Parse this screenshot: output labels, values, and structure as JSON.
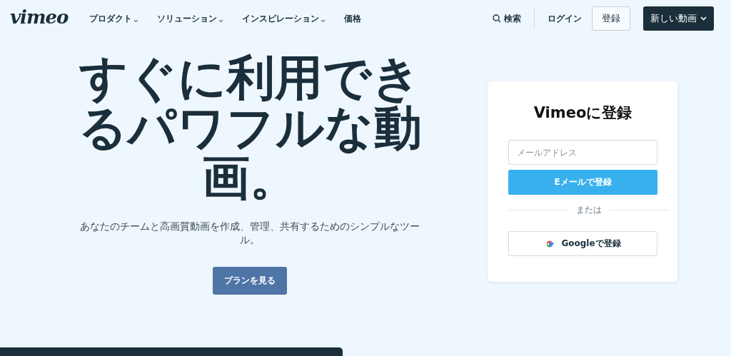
{
  "header": {
    "logo": "vimeo",
    "nav": [
      {
        "label": "プロダクト",
        "has_menu": true
      },
      {
        "label": "ソリューション",
        "has_menu": true
      },
      {
        "label": "インスピレーション",
        "has_menu": true
      },
      {
        "label": "価格",
        "has_menu": false
      }
    ],
    "search": "検索",
    "login": "ログイン",
    "signup": "登録",
    "new_video": "新しい動画"
  },
  "hero": {
    "headline_lines": [
      "すぐに利用でき",
      "るパワフルな動",
      "画。"
    ],
    "subtitle": "あなたのチームと高画質動画を作成、管理、共有するためのシンプルなツール。",
    "button": "プランを見る"
  },
  "signup_card": {
    "title": "Vimeoに登録",
    "email_placeholder": "メールアドレス",
    "email_button": "Eメールで登録",
    "divider": "または",
    "google_button": "Googleで登録"
  }
}
